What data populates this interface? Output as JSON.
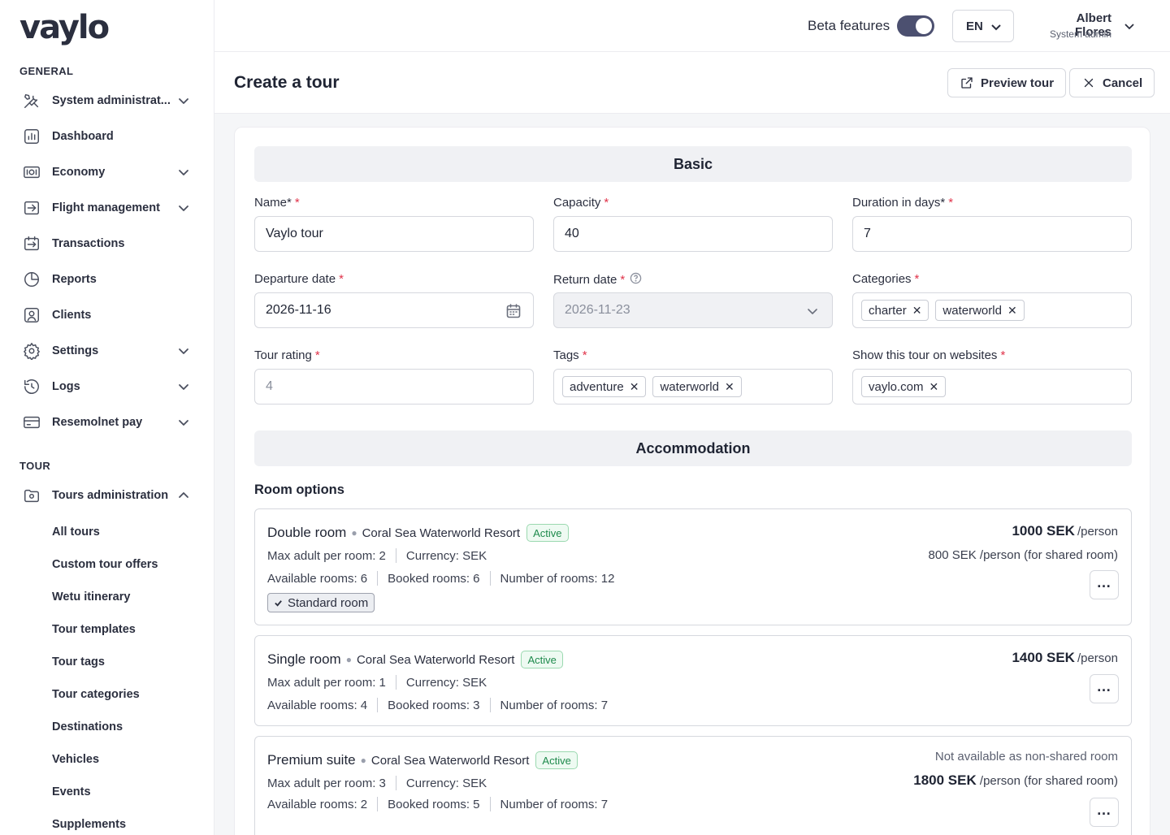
{
  "app": {
    "logo": "vaylo"
  },
  "sidebar": {
    "general_label": "GENERAL",
    "tour_label": "TOUR",
    "items": [
      {
        "label": "System administrat...",
        "icon": "tools-icon",
        "expandable": true
      },
      {
        "label": "Dashboard",
        "icon": "dashboard-icon",
        "expandable": false
      },
      {
        "label": "Economy",
        "icon": "money-icon",
        "expandable": true
      },
      {
        "label": "Flight management",
        "icon": "flight-icon",
        "expandable": true
      },
      {
        "label": "Transactions",
        "icon": "transactions-icon",
        "expandable": false
      },
      {
        "label": "Reports",
        "icon": "pie-chart-icon",
        "expandable": false
      },
      {
        "label": "Clients",
        "icon": "user-icon",
        "expandable": false
      },
      {
        "label": "Settings",
        "icon": "gear-icon",
        "expandable": true
      },
      {
        "label": "Logs",
        "icon": "history-icon",
        "expandable": true
      },
      {
        "label": "Resemolnet pay",
        "icon": "card-icon",
        "expandable": true
      }
    ],
    "tours_admin": {
      "label": "Tours administration",
      "icon": "folder-icon",
      "expanded": true
    },
    "sub_items": [
      "All tours",
      "Custom tour offers",
      "Wetu itinerary",
      "Tour templates",
      "Tour tags",
      "Tour categories",
      "Destinations",
      "Vehicles",
      "Events",
      "Supplements"
    ]
  },
  "topbar": {
    "beta_label": "Beta features",
    "beta_enabled": true,
    "language": "EN",
    "user_name": "Albert Flores",
    "user_role": "System admin"
  },
  "page": {
    "title": "Create a tour",
    "preview_label": "Preview tour",
    "cancel_label": "Cancel"
  },
  "basic": {
    "heading": "Basic",
    "name": {
      "label": "Name*",
      "value": "Vaylo tour"
    },
    "capacity": {
      "label": "Capacity",
      "value": "40"
    },
    "duration": {
      "label": "Duration in days*",
      "value": "7"
    },
    "departure": {
      "label": "Departure date",
      "value": "2026-11-16"
    },
    "return": {
      "label": "Return date",
      "value": "2026-11-23"
    },
    "categories": {
      "label": "Categories",
      "tags": [
        "charter",
        "waterworld"
      ]
    },
    "rating": {
      "label": "Tour rating",
      "placeholder": "4"
    },
    "tags": {
      "label": "Tags",
      "tags": [
        "adventure",
        "waterworld"
      ]
    },
    "websites": {
      "label": "Show this tour on websites",
      "tags": [
        "vaylo.com"
      ]
    },
    "required_mark": "*"
  },
  "accommodation": {
    "heading": "Accommodation",
    "room_options_label": "Room options",
    "rooms": [
      {
        "name": "Double room",
        "hotel": "Coral Sea Waterworld Resort",
        "status": "Active",
        "max_adult": "Max adult per room: 2",
        "currency": "Currency: SEK",
        "available": "Available rooms: 6",
        "booked": "Booked rooms: 6",
        "number": "Number of rooms: 12",
        "room_type": "Standard room",
        "price": "1000 SEK",
        "price_unit": "/person",
        "shared_price": "800 SEK",
        "shared_unit": "/person (for shared room)"
      },
      {
        "name": "Single room",
        "hotel": "Coral Sea Waterworld Resort",
        "status": "Active",
        "max_adult": "Max adult per room: 1",
        "currency": "Currency: SEK",
        "available": "Available rooms: 4",
        "booked": "Booked rooms: 3",
        "number": "Number of rooms: 7",
        "price": "1400 SEK",
        "price_unit": "/person"
      },
      {
        "name": "Premium suite",
        "hotel": "Coral Sea Waterworld Resort",
        "status": "Active",
        "max_adult": "Max adult per room: 3",
        "currency": "Currency: SEK",
        "available": "Available rooms: 2",
        "booked": "Booked rooms: 5",
        "number": "Number of rooms: 7",
        "note": "Not available as non-shared room",
        "shared_price": "1800 SEK",
        "shared_unit": "/person (for shared room)"
      }
    ]
  },
  "colors": {
    "accent": "#4c5070",
    "required": "#e0334a",
    "active_badge": "#1e8a4c"
  }
}
